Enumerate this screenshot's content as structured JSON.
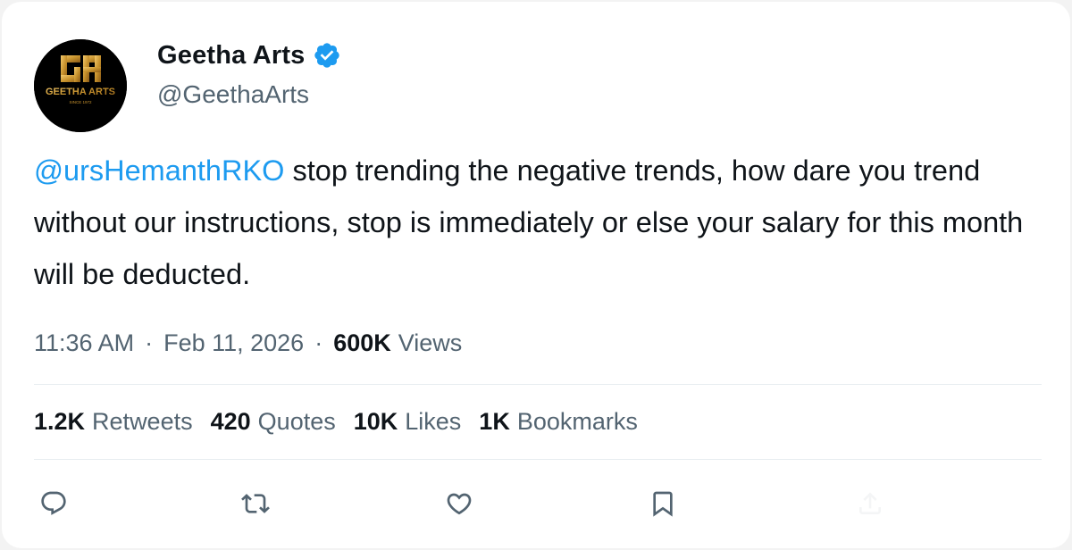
{
  "author": {
    "display_name": "Geetha Arts",
    "handle": "@GeethaArts",
    "verified": true,
    "avatar_logo_text": "GEETHA ARTS",
    "avatar_monogram": "GA",
    "avatar_tagline": "SINCE 1972"
  },
  "tweet": {
    "mention": "@ursHemanthRKO",
    "body": " stop trending the negative trends, how dare you trend without our instructions, stop is immediately or else your salary for this month will be deducted."
  },
  "meta": {
    "time": "11:36 AM",
    "separator": "·",
    "date": "Feb 11, 2026",
    "views_count": "600K",
    "views_label": "Views"
  },
  "stats": [
    {
      "count": "1.2K",
      "label": "Retweets"
    },
    {
      "count": "420",
      "label": "Quotes"
    },
    {
      "count": "10K",
      "label": "Likes"
    },
    {
      "count": "1K",
      "label": "Bookmarks"
    }
  ],
  "actions": [
    {
      "icon": "reply-icon"
    },
    {
      "icon": "retweet-icon"
    },
    {
      "icon": "like-icon"
    },
    {
      "icon": "bookmark-icon"
    },
    {
      "icon": "share-icon"
    }
  ],
  "colors": {
    "text": "#0f1419",
    "secondary": "#536471",
    "link": "#1d9bf0",
    "verified": "#1d9bf0",
    "logo_gold": "#c8932e"
  }
}
